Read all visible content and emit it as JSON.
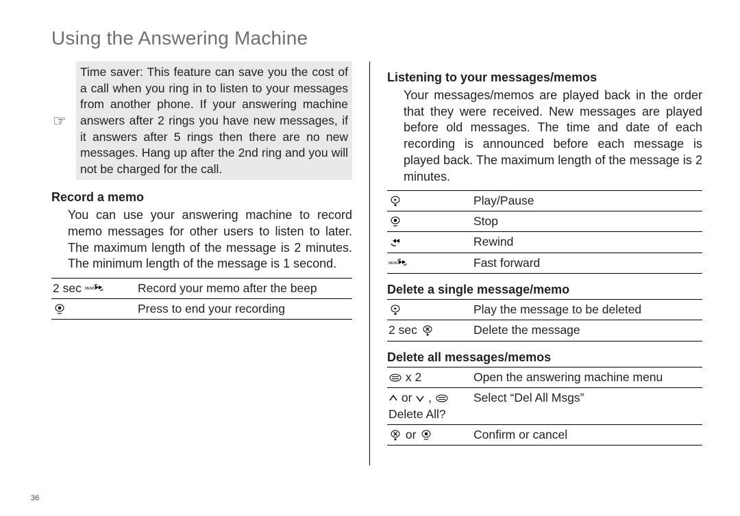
{
  "pageNumber": "36",
  "title": "Using the Answering Machine",
  "timesaver": {
    "label": "Time saver:",
    "text": " This feature can save you the cost of a call when you ring in to listen to your messages from another phone. If your answering machine answers after 2 rings you have new messages, if it answers after 5 rings then there are no new messages. Hang up after the 2nd ring and you will not be charged for the call."
  },
  "record": {
    "heading": "Record a memo",
    "para": "You can use your answering machine to record memo messages for other users to listen to later. The maximum length of the message is 2 minutes. The minimum length of the message is 1 second.",
    "rows": [
      {
        "left_pre": "2 sec ",
        "icon": "memo-fwd",
        "right": "Record your memo after the beep"
      },
      {
        "icon": "stop",
        "right": "Press to end your recording"
      }
    ]
  },
  "listening": {
    "heading": "Listening to your messages/memos",
    "para": "Your messages/memos are played back in the order that they were received. New messages are played before old messages. The time and date of each recording is announced before each message is played back. The maximum length of the message is 2 minutes.",
    "rows": [
      {
        "icon": "play",
        "right": "Play/Pause"
      },
      {
        "icon": "stop",
        "right": "Stop"
      },
      {
        "icon": "rewind",
        "right": "Rewind"
      },
      {
        "icon": "memo-fwd",
        "right": "Fast forward"
      }
    ]
  },
  "delsingle": {
    "heading": "Delete a single message/memo",
    "rows": [
      {
        "icon": "play",
        "right": "Play the message to be deleted"
      },
      {
        "left_pre": "2 sec ",
        "icon": "delete",
        "right": "Delete the message"
      }
    ]
  },
  "delall": {
    "heading": "Delete all messages/memos",
    "rows": [
      {
        "icon": "menu",
        "left_post": " x 2",
        "right": "Open the answering machine menu"
      },
      {
        "icon": "up",
        "between": " or ",
        "icon2": "down",
        "between2": " , ",
        "icon3": "menu",
        "sub": "Delete All?",
        "right": "Select “Del All Msgs”"
      },
      {
        "icon": "delete",
        "between": " or ",
        "icon2": "stop",
        "right": "Confirm or cancel"
      }
    ]
  }
}
